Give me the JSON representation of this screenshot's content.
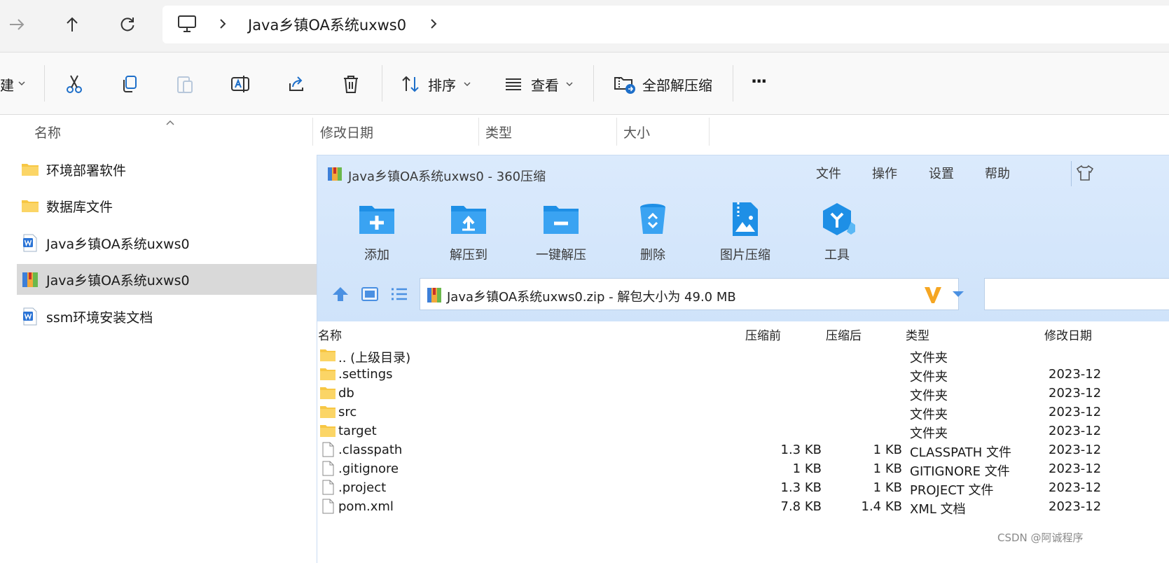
{
  "explorer": {
    "address": {
      "breadcrumb": "Java乡镇OA系统uxws0"
    },
    "toolbar": {
      "new_partial": "建",
      "sort_label": "排序",
      "view_label": "查看",
      "extract_all_label": "全部解压缩",
      "more_label": "···"
    },
    "columns": [
      "名称",
      "修改日期",
      "类型",
      "大小"
    ],
    "items": [
      {
        "name": "环境部署软件",
        "icon": "folder-icon"
      },
      {
        "name": "数据库文件",
        "icon": "folder-icon"
      },
      {
        "name": "Java乡镇OA系统uxws0",
        "icon": "word-doc-icon"
      },
      {
        "name": "Java乡镇OA系统uxws0",
        "icon": "archive-icon",
        "selected": true
      },
      {
        "name": "ssm环境安装文档",
        "icon": "word-doc-icon"
      }
    ]
  },
  "zip_window": {
    "title": "Java乡镇OA系统uxws0 - 360压缩",
    "menu": [
      "文件",
      "操作",
      "设置",
      "帮助"
    ],
    "actions": [
      "添加",
      "解压到",
      "一键解压",
      "删除",
      "图片压缩",
      "工具"
    ],
    "path": "Java乡镇OA系统uxws0.zip - 解包大小为 49.0 MB",
    "columns": [
      "名称",
      "压缩前",
      "压缩后",
      "类型",
      "修改日期"
    ],
    "rows": [
      {
        "name": ".. (上级目录)",
        "before": "",
        "after": "",
        "type": "文件夹",
        "date": "",
        "icon": "folder-icon"
      },
      {
        "name": ".settings",
        "before": "",
        "after": "",
        "type": "文件夹",
        "date": "2023-12",
        "icon": "folder-icon"
      },
      {
        "name": "db",
        "before": "",
        "after": "",
        "type": "文件夹",
        "date": "2023-12",
        "icon": "folder-icon"
      },
      {
        "name": "src",
        "before": "",
        "after": "",
        "type": "文件夹",
        "date": "2023-12",
        "icon": "folder-icon"
      },
      {
        "name": "target",
        "before": "",
        "after": "",
        "type": "文件夹",
        "date": "2023-12",
        "icon": "folder-icon"
      },
      {
        "name": ".classpath",
        "before": "1.3 KB",
        "after": "1 KB",
        "type": "CLASSPATH 文件",
        "date": "2023-12",
        "icon": "file-icon"
      },
      {
        "name": ".gitignore",
        "before": "1 KB",
        "after": "1 KB",
        "type": "GITIGNORE 文件",
        "date": "2023-12",
        "icon": "file-icon"
      },
      {
        "name": ".project",
        "before": "1.3 KB",
        "after": "1 KB",
        "type": "PROJECT 文件",
        "date": "2023-12",
        "icon": "file-icon"
      },
      {
        "name": "pom.xml",
        "before": "7.8 KB",
        "after": "1.4 KB",
        "type": "XML 文档",
        "date": "2023-12",
        "icon": "file-icon"
      }
    ]
  },
  "watermark": "CSDN @阿诚程序",
  "colors": {
    "folder": "#f7c744",
    "accent_blue": "#1e8fe6",
    "zip_header": "#d6e7fb",
    "selected_row": "#d9d9d9"
  }
}
